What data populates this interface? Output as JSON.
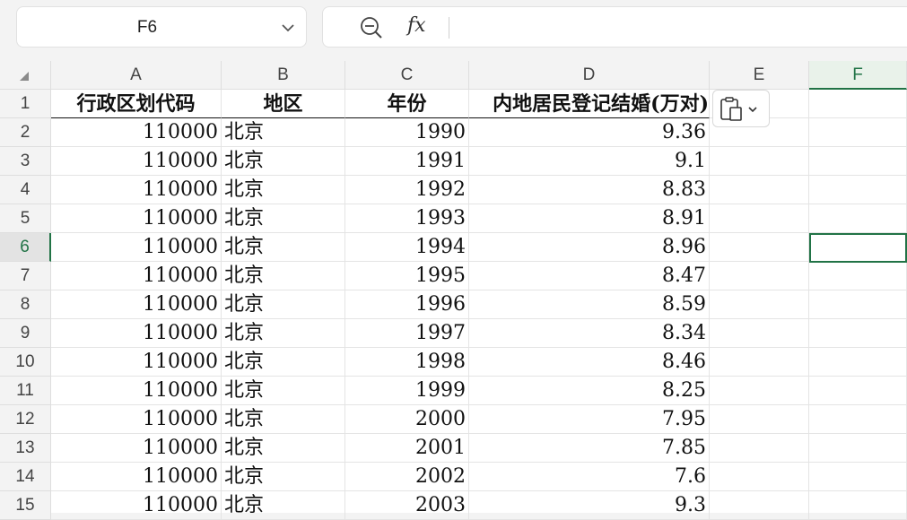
{
  "toolbar": {
    "cell_ref": "F6"
  },
  "columns": [
    "A",
    "B",
    "C",
    "D",
    "E",
    "F"
  ],
  "selected_column": "F",
  "selected_row": "6",
  "headers": {
    "a": "行政区划代码",
    "b": "地区",
    "c": "年份",
    "d": "内地居民登记结婚(万对)"
  },
  "rows": [
    {
      "n": "1"
    },
    {
      "n": "2",
      "a": "110000",
      "b": "北京",
      "c": "1990",
      "d": "9.36"
    },
    {
      "n": "3",
      "a": "110000",
      "b": "北京",
      "c": "1991",
      "d": "9.1"
    },
    {
      "n": "4",
      "a": "110000",
      "b": "北京",
      "c": "1992",
      "d": "8.83"
    },
    {
      "n": "5",
      "a": "110000",
      "b": "北京",
      "c": "1993",
      "d": "8.91"
    },
    {
      "n": "6",
      "a": "110000",
      "b": "北京",
      "c": "1994",
      "d": "8.96"
    },
    {
      "n": "7",
      "a": "110000",
      "b": "北京",
      "c": "1995",
      "d": "8.47"
    },
    {
      "n": "8",
      "a": "110000",
      "b": "北京",
      "c": "1996",
      "d": "8.59"
    },
    {
      "n": "9",
      "a": "110000",
      "b": "北京",
      "c": "1997",
      "d": "8.34"
    },
    {
      "n": "10",
      "a": "110000",
      "b": "北京",
      "c": "1998",
      "d": "8.46"
    },
    {
      "n": "11",
      "a": "110000",
      "b": "北京",
      "c": "1999",
      "d": "8.25"
    },
    {
      "n": "12",
      "a": "110000",
      "b": "北京",
      "c": "2000",
      "d": "7.95"
    },
    {
      "n": "13",
      "a": "110000",
      "b": "北京",
      "c": "2001",
      "d": "7.85"
    },
    {
      "n": "14",
      "a": "110000",
      "b": "北京",
      "c": "2002",
      "d": "7.6"
    },
    {
      "n": "15",
      "a": "110000",
      "b": "北京",
      "c": "2003",
      "d": "9.3"
    }
  ]
}
